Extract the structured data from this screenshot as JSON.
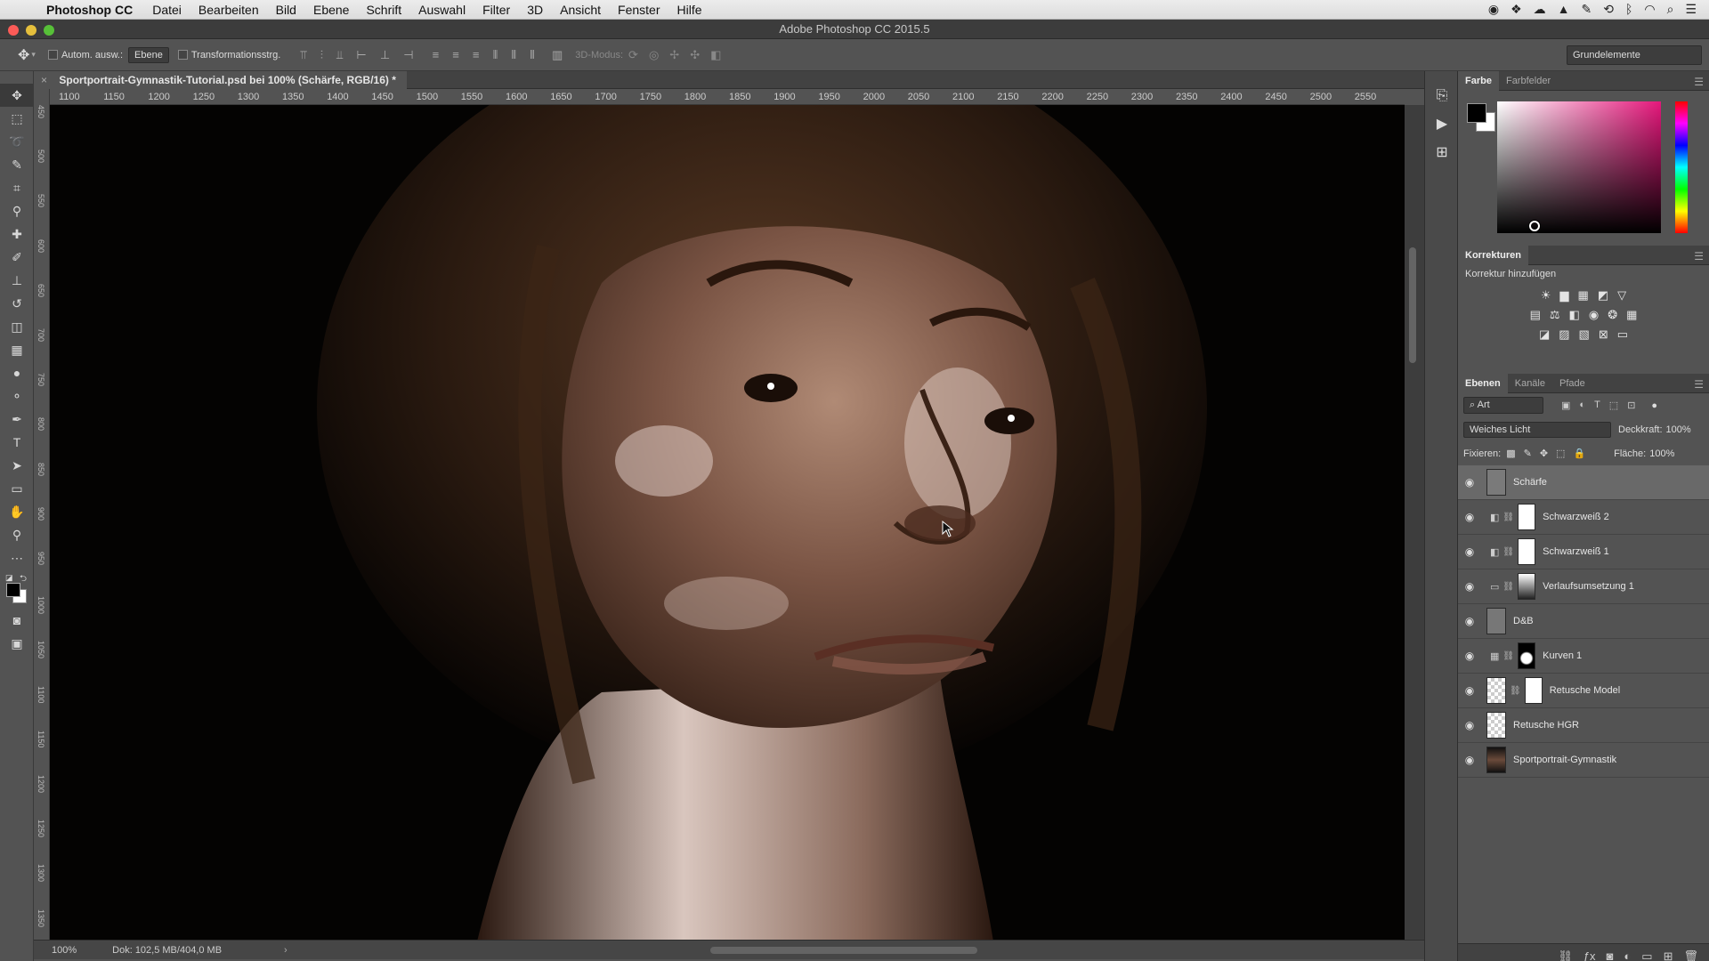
{
  "menubar": {
    "app_name": "Photoshop CC",
    "items": [
      "Datei",
      "Bearbeiten",
      "Bild",
      "Ebene",
      "Schrift",
      "Auswahl",
      "Filter",
      "3D",
      "Ansicht",
      "Fenster",
      "Hilfe"
    ]
  },
  "window": {
    "title": "Adobe Photoshop CC 2015.5"
  },
  "options": {
    "auto_select_label": "Autom. ausw.:",
    "auto_select_value": "Ebene",
    "transform_label": "Transformationsstrg.",
    "mode_3d_label": "3D-Modus:",
    "workspace": "Grundelemente"
  },
  "document": {
    "tab_title": "Sportportrait-Gymnastik-Tutorial.psd bei 100% (Schärfe, RGB/16) *",
    "zoom": "100%",
    "doc_info": "Dok: 102,5 MB/404,0 MB"
  },
  "ruler": {
    "h_labels": [
      "1100",
      "1150",
      "1200",
      "1250",
      "1300",
      "1350",
      "1400",
      "1450",
      "1500",
      "1550",
      "1600",
      "1650",
      "1700",
      "1750",
      "1800",
      "1850",
      "1900",
      "1950",
      "2000",
      "2050",
      "2100",
      "2150",
      "2200",
      "2250",
      "2300",
      "2350",
      "2400",
      "2450",
      "2500",
      "2550"
    ],
    "v_labels": [
      "450",
      "500",
      "550",
      "600",
      "650",
      "700",
      "750",
      "800",
      "850",
      "900",
      "950",
      "1000",
      "1050",
      "1100",
      "1150",
      "1200",
      "1250",
      "1300",
      "1350"
    ]
  },
  "color_panel": {
    "tabs": [
      "Farbe",
      "Farbfelder"
    ],
    "accent": "#e5177b"
  },
  "adjustments_panel": {
    "title": "Korrekturen",
    "subtitle": "Korrektur hinzufügen"
  },
  "layers_panel": {
    "tabs": [
      "Ebenen",
      "Kanäle",
      "Pfade"
    ],
    "filter_kind": "Art",
    "blend_mode": "Weiches Licht",
    "opacity_label": "Deckkraft:",
    "opacity_value": "100%",
    "lock_label": "Fixieren:",
    "fill_label": "Fläche:",
    "fill_value": "100%",
    "layers": [
      {
        "name": "Schärfe"
      },
      {
        "name": "Schwarzweiß 2"
      },
      {
        "name": "Schwarzweiß 1"
      },
      {
        "name": "Verlaufsumsetzung 1"
      },
      {
        "name": "D&B"
      },
      {
        "name": "Kurven 1"
      },
      {
        "name": "Retusche Model"
      },
      {
        "name": "Retusche HGR"
      },
      {
        "name": "Sportportrait-Gymnastik"
      }
    ]
  }
}
